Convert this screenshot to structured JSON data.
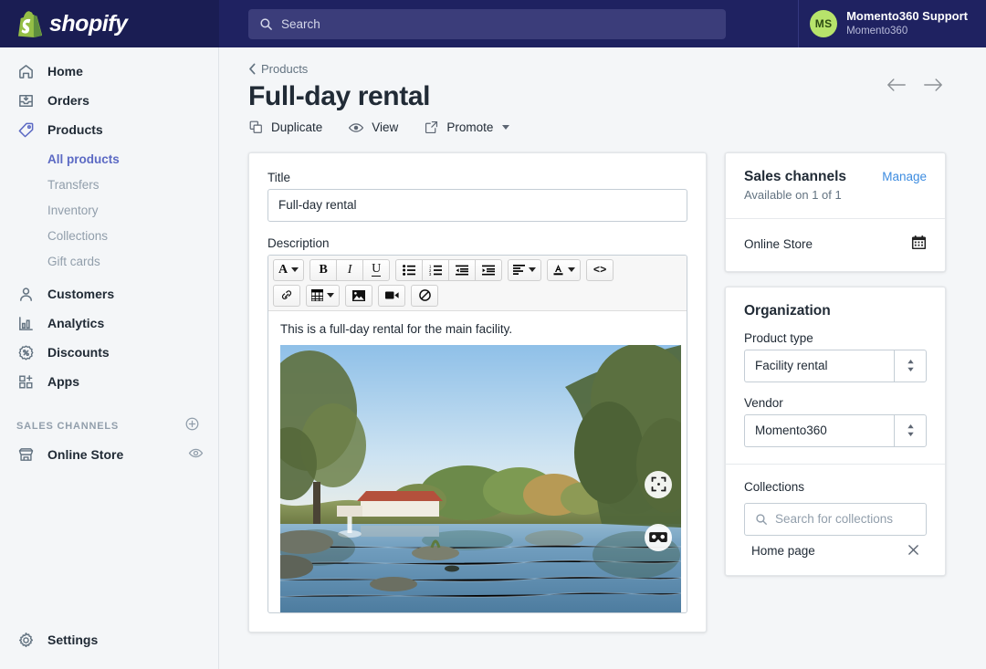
{
  "topbar": {
    "logo_text": "shopify",
    "logo_icon": "shopify-bag-icon",
    "search_placeholder": "Search",
    "search_icon": "search-icon",
    "user": {
      "initials": "MS",
      "name": "Momento360 Support",
      "store": "Momento360"
    }
  },
  "sidebar": {
    "items": [
      {
        "label": "Home",
        "icon": "home-icon"
      },
      {
        "label": "Orders",
        "icon": "orders-inbox-icon"
      },
      {
        "label": "Products",
        "icon": "products-tag-icon"
      }
    ],
    "product_subitems": [
      {
        "label": "All products",
        "active": true
      },
      {
        "label": "Transfers",
        "active": false
      },
      {
        "label": "Inventory",
        "active": false
      },
      {
        "label": "Collections",
        "active": false
      },
      {
        "label": "Gift cards",
        "active": false
      }
    ],
    "items2": [
      {
        "label": "Customers",
        "icon": "customer-person-icon"
      },
      {
        "label": "Analytics",
        "icon": "analytics-bars-icon"
      },
      {
        "label": "Discounts",
        "icon": "discount-percent-icon"
      },
      {
        "label": "Apps",
        "icon": "apps-grid-plus-icon"
      }
    ],
    "sales_channels_title": "SALES CHANNELS",
    "sales_channels_add_icon": "plus-circle-icon",
    "channels": [
      {
        "label": "Online Store",
        "icon": "storefront-icon",
        "action_icon": "eye-icon"
      }
    ],
    "settings": {
      "label": "Settings",
      "icon": "gear-icon"
    }
  },
  "page": {
    "breadcrumb": "Products",
    "breadcrumb_icon": "chevron-left-icon",
    "title": "Full-day rental",
    "actions": [
      {
        "label": "Duplicate",
        "icon": "duplicate-icon",
        "caret": false
      },
      {
        "label": "View",
        "icon": "eye-icon",
        "caret": false
      },
      {
        "label": "Promote",
        "icon": "external-link-icon",
        "caret": true
      }
    ],
    "nav_back_icon": "arrow-left-icon",
    "nav_forward_icon": "arrow-right-icon"
  },
  "product_card": {
    "title_label": "Title",
    "title_value": "Full-day rental",
    "description_label": "Description",
    "description_text": "This is a full-day rental for the main facility.",
    "toolbar_row1": [
      {
        "group": [
          {
            "icon": "font-size-A-icon",
            "glyph": "A",
            "caret": true
          }
        ]
      },
      {
        "group": [
          {
            "icon": "bold-icon",
            "glyph": "B",
            "caret": false
          },
          {
            "icon": "italic-icon",
            "glyph": "I",
            "caret": false
          },
          {
            "icon": "underline-icon",
            "glyph": "U",
            "caret": false
          }
        ]
      },
      {
        "group": [
          {
            "icon": "bullet-list-icon",
            "glyph": "",
            "caret": false
          },
          {
            "icon": "numbered-list-icon",
            "glyph": "",
            "caret": false
          },
          {
            "icon": "outdent-icon",
            "glyph": "",
            "caret": false
          },
          {
            "icon": "indent-icon",
            "glyph": "",
            "caret": false
          }
        ]
      },
      {
        "group": [
          {
            "icon": "align-left-icon",
            "glyph": "",
            "caret": true
          }
        ]
      },
      {
        "group": [
          {
            "icon": "text-color-icon",
            "glyph": "A",
            "caret": true
          }
        ]
      },
      {
        "group": [
          {
            "icon": "code-view-icon",
            "glyph": "<>",
            "caret": false
          }
        ]
      }
    ],
    "toolbar_row2": [
      {
        "group": [
          {
            "icon": "link-icon",
            "glyph": "",
            "caret": false
          }
        ]
      },
      {
        "group": [
          {
            "icon": "table-icon",
            "glyph": "",
            "caret": true
          }
        ]
      },
      {
        "group": [
          {
            "icon": "insert-image-icon",
            "glyph": "",
            "caret": false
          }
        ]
      },
      {
        "group": [
          {
            "icon": "insert-video-icon",
            "glyph": "",
            "caret": false
          }
        ]
      },
      {
        "group": [
          {
            "icon": "clear-formatting-icon",
            "glyph": "",
            "caret": false
          }
        ]
      }
    ],
    "panorama": {
      "alt": "360 panorama of a pond with trees, fountain and red-roofed building",
      "fullscreen_icon": "fullscreen-expand-icon",
      "vr_icon": "vr-cardboard-icon"
    }
  },
  "sales_channels": {
    "title": "Sales channels",
    "manage_label": "Manage",
    "availability": "Available on 1 of 1",
    "channels": [
      {
        "name": "Online Store",
        "icon": "calendar-icon"
      }
    ]
  },
  "organization": {
    "title": "Organization",
    "product_type_label": "Product type",
    "product_type_value": "Facility rental",
    "vendor_label": "Vendor",
    "vendor_value": "Momento360",
    "select_icon": "select-stepper-icon"
  },
  "collections": {
    "label": "Collections",
    "search_placeholder": "Search for collections",
    "search_icon": "search-icon",
    "items": [
      {
        "name": "Home page",
        "remove_icon": "close-x-icon"
      }
    ]
  },
  "colors": {
    "topbar_bg": "#1f2261",
    "logo_bg": "#1a1d53",
    "accent_indigo": "#5c6ac4",
    "link_blue": "#3d8ce0",
    "avatar_green": "#b7e36b",
    "page_bg": "#f4f6f8",
    "text_dark": "#212b36",
    "text_muted": "#919eab"
  }
}
